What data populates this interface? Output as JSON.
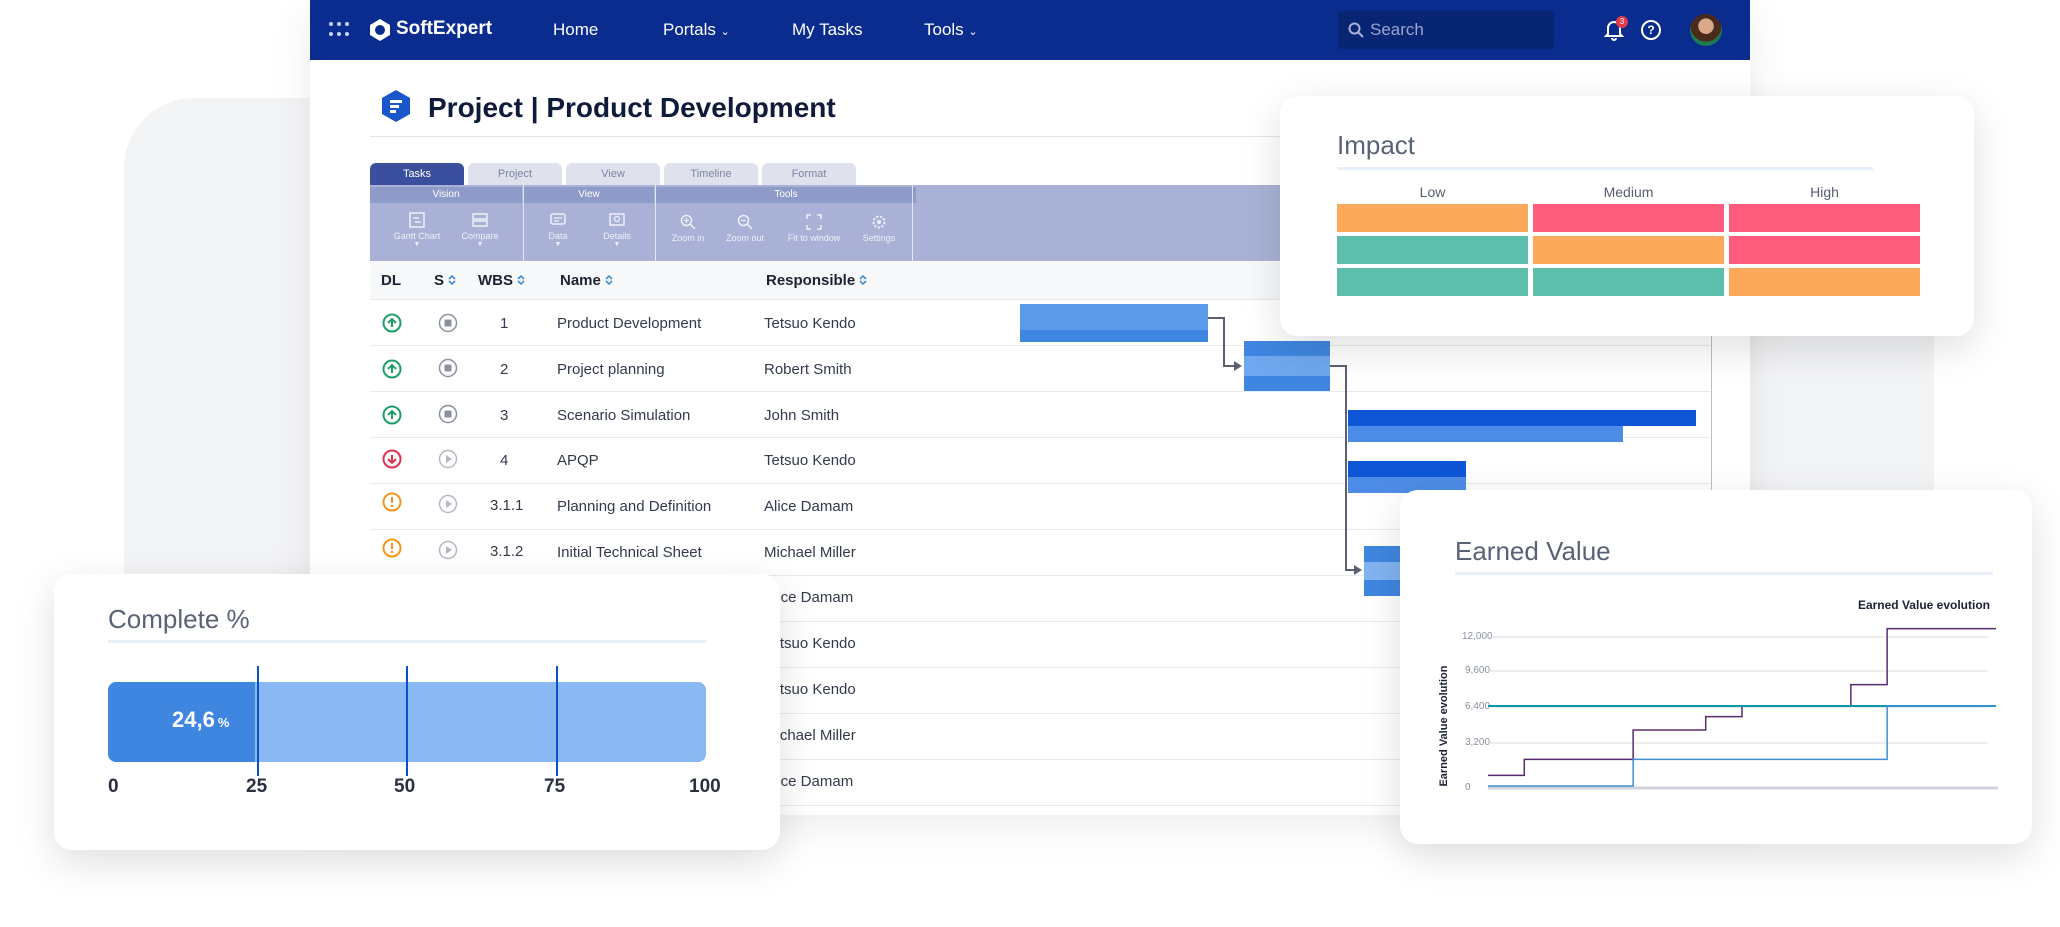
{
  "nav": {
    "brand": "SoftExpert",
    "items": [
      "Home",
      "Portals",
      "My Tasks",
      "Tools"
    ],
    "search_placeholder": "Search",
    "notification_count": "3"
  },
  "page": {
    "title": "Project | Product Development"
  },
  "ribbon": {
    "tabs": [
      "Tasks",
      "Project",
      "View",
      "Timeline",
      "Format"
    ],
    "groups": [
      "Vision",
      "View",
      "Tools"
    ],
    "buttons": [
      "Gantt Chart",
      "Compare",
      "Data",
      "Details",
      "Zoom in",
      "Zoom out",
      "Fit to window",
      "Settings"
    ]
  },
  "grid": {
    "headers": [
      "DL",
      "S",
      "WBS",
      "Name",
      "Responsible"
    ],
    "rows": [
      {
        "wbs": "1",
        "name": "Product Development",
        "responsible": "Tetsuo Kendo",
        "dl": "up-green"
      },
      {
        "wbs": "2",
        "name": "Project planning",
        "responsible": "Robert Smith",
        "dl": "up-green"
      },
      {
        "wbs": "3",
        "name": "Scenario Simulation",
        "responsible": "John Smith",
        "dl": "up-green"
      },
      {
        "wbs": "4",
        "name": "APQP",
        "responsible": "Tetsuo Kendo",
        "dl": "down-red"
      },
      {
        "wbs": "3.1.1",
        "name": "Planning and Definition",
        "responsible": "Alice Damam",
        "dl": "warn-orange"
      },
      {
        "wbs": "3.1.2",
        "name": "Initial Technical Sheet",
        "responsible": "Michael Miller",
        "dl": "warn-orange"
      },
      {
        "wbs": "",
        "name": "",
        "responsible": "Alice Damam",
        "dl": ""
      },
      {
        "wbs": "",
        "name": "",
        "responsible": "Tetsuo Kendo",
        "dl": ""
      },
      {
        "wbs": "",
        "name": "",
        "responsible": "Tetsuo Kendo",
        "dl": ""
      },
      {
        "wbs": "",
        "name": "",
        "responsible": "Michael Miller",
        "dl": ""
      },
      {
        "wbs": "",
        "name": "",
        "responsible": "Alice Damam",
        "dl": ""
      }
    ]
  },
  "impact": {
    "title": "Impact",
    "columns": [
      "Low",
      "Medium",
      "High"
    ],
    "matrix": [
      [
        "orange",
        "red",
        "red"
      ],
      [
        "green",
        "orange",
        "red"
      ],
      [
        "green",
        "green",
        "orange"
      ]
    ],
    "colors": {
      "orange": "#fba85a",
      "red": "#fe5c7d",
      "green": "#5dbfab"
    }
  },
  "complete": {
    "title": "Complete %",
    "value_text": "24,6",
    "unit": "%",
    "value": 24.6,
    "ticks": [
      "0",
      "25",
      "50",
      "75",
      "100"
    ]
  },
  "chart_data": {
    "type": "line",
    "title": "Earned Value",
    "legend": "Earned Value evolution",
    "ylabel": "Earned Value evolution",
    "yticks": [
      "12,000",
      "9,600",
      "6,400",
      "3,200",
      "0"
    ],
    "ylim": [
      0,
      12000
    ],
    "x": [
      0,
      1,
      2,
      3,
      4,
      5,
      6,
      7,
      8,
      9,
      10,
      11,
      12,
      13,
      14
    ],
    "series": [
      {
        "color": "#5b2a6e",
        "values": [
          800,
          2000,
          2000,
          2000,
          4200,
          4200,
          5200,
          6000,
          6000,
          6000,
          7600,
          11800,
          11800,
          11800,
          11800
        ]
      },
      {
        "color": "#0a97a6",
        "values": [
          6000,
          6000,
          6000,
          6000,
          6000,
          6000,
          6000,
          6000,
          6000,
          6000,
          6000,
          6000,
          6000,
          6000,
          6000
        ]
      },
      {
        "color": "#3f8fd8",
        "values": [
          0,
          0,
          0,
          0,
          2000,
          2000,
          2000,
          2000,
          2000,
          2000,
          2000,
          6000,
          6000,
          6000,
          6000
        ]
      }
    ]
  }
}
